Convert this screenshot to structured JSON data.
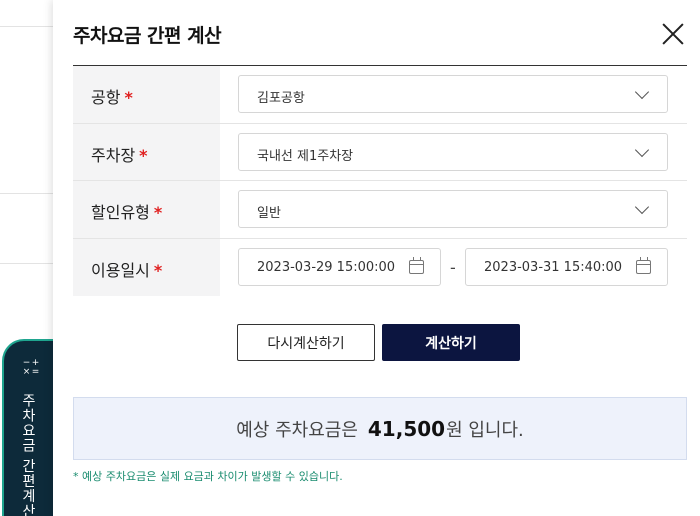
{
  "side_tab": {
    "label": "주차요금 간편계산",
    "icon": "calculator-icon"
  },
  "modal": {
    "title": "주차요금 간편 계산",
    "close_icon": "close-icon"
  },
  "form": {
    "required_mark": "*",
    "airport": {
      "label": "공항",
      "value": "김포공항"
    },
    "parking_lot": {
      "label": "주차장",
      "value": "국내선 제1주차장"
    },
    "discount_type": {
      "label": "할인유형",
      "value": "일반"
    },
    "period": {
      "label": "이용일시",
      "start": "2023-03-29 15:00:00",
      "end": "2023-03-31 15:40:00",
      "separator": "-"
    }
  },
  "buttons": {
    "reset": "다시계산하기",
    "calculate": "계산하기"
  },
  "result": {
    "prefix": "예상 주차요금은",
    "amount": "41,500",
    "suffix": "원 입니다."
  },
  "notice": "* 예상 주차요금은 실제 요금과 차이가 발생할 수 있습니다.",
  "colors": {
    "primary": "#0c1540",
    "accent": "#1a8c6f",
    "required": "#e02020",
    "result_bg": "#eef2fb"
  }
}
